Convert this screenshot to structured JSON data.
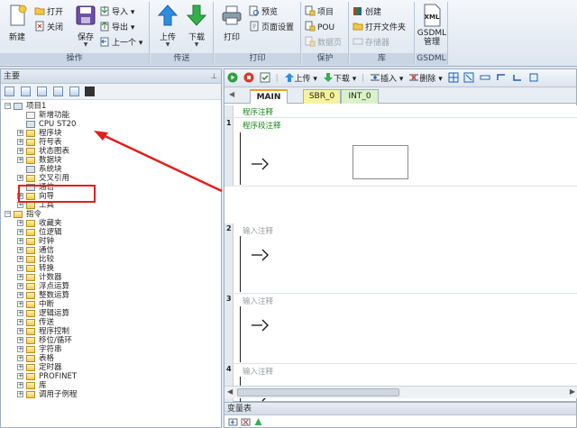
{
  "ribbon": {
    "groups": {
      "operations": "操作",
      "transfer": "传送",
      "print": "打印",
      "protect": "保护",
      "library": "库",
      "gsdml": "GSDML"
    },
    "new_label": "新建",
    "open_label": "打开",
    "close_label": "关闭",
    "save_label": "保存",
    "import_label": "导入",
    "export_label": "导出",
    "prev_label": "上一个",
    "upload_label": "上传",
    "download_label": "下载",
    "print_label": "打印",
    "preview_label": "预览",
    "page_setup_label": "页面设置",
    "project_label": "项目",
    "pou_label": "POU",
    "data_page_label": "数据页",
    "create_label": "创建",
    "open_folder_label": "打开文件夹",
    "memory_label": "存储器",
    "gsdml_manage_label": "GSDML\n管理",
    "xml_icon_text": "XML"
  },
  "left_panel": {
    "title": "主要",
    "project_tree": {
      "root": "项目1",
      "items": [
        "新增功能",
        "CPU ST20",
        "程序块",
        "符号表",
        "状态图表",
        "数据块",
        "系统块",
        "交叉引用",
        "通信",
        "向导",
        "工具"
      ]
    },
    "instructions_tree": {
      "root": "指令",
      "items": [
        "收藏夹",
        "位逻辑",
        "时钟",
        "通信",
        "比较",
        "转换",
        "计数器",
        "浮点运算",
        "整数运算",
        "中断",
        "逻辑运算",
        "传送",
        "程序控制",
        "移位/循环",
        "字符串",
        "表格",
        "定时器",
        "PROFINET",
        "库",
        "调用子例程"
      ]
    }
  },
  "editor": {
    "toolbar": {
      "upload_label": "上传",
      "download_label": "下载",
      "insert_label": "插入",
      "delete_label": "删除"
    },
    "tabs": [
      "MAIN",
      "SBR_0",
      "INT_0"
    ],
    "program_comment": "程序注释",
    "networks": [
      {
        "number": "1",
        "comment": "程序段注释"
      },
      {
        "number": "2",
        "comment": "输入注释"
      },
      {
        "number": "3",
        "comment": "输入注释"
      },
      {
        "number": "4",
        "comment": "输入注释"
      }
    ]
  },
  "bottom_panel": {
    "title": "变量表"
  },
  "colors": {
    "highlight": "#e0201c",
    "active_tab": "#ffffff",
    "sbr_tab": "#f6f39a",
    "int_tab": "#d9f2c8",
    "comment_green": "#1a8a1a"
  }
}
